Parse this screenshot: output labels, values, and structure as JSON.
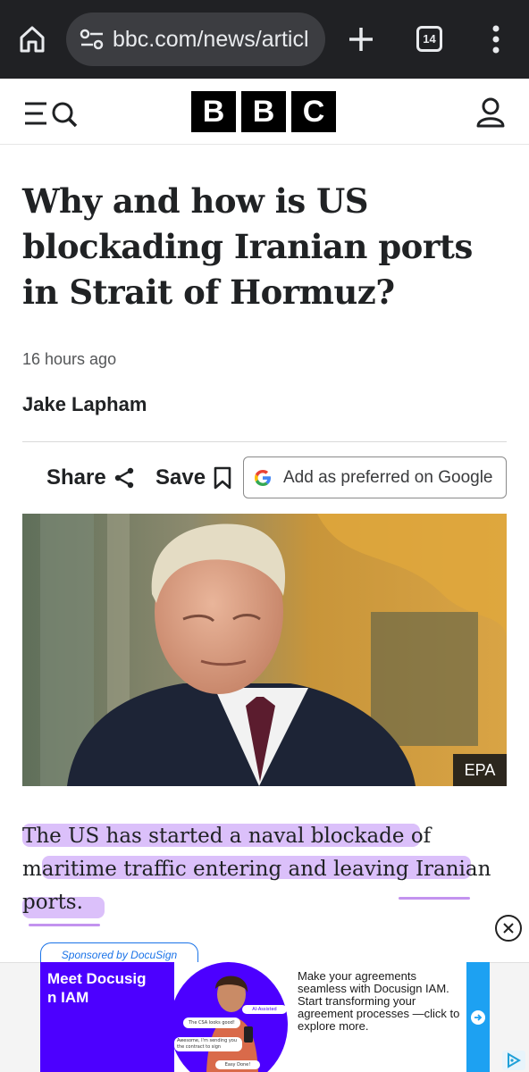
{
  "browser": {
    "url": "bbc.com/news/articl",
    "tab_count": "14",
    "icons": [
      "home-icon",
      "site-settings-icon",
      "new-tab-icon",
      "tab-switcher-icon",
      "more-menu-icon"
    ]
  },
  "site_header": {
    "logo_letters": [
      "B",
      "B",
      "C"
    ],
    "icons": [
      "menu-search-icon",
      "account-icon"
    ]
  },
  "article": {
    "headline": "Why and how is US blockading Iranian ports in Strait of Hormuz?",
    "timestamp": "16 hours ago",
    "author": "Jake Lapham",
    "actions": {
      "share_label": "Share",
      "save_label": "Save",
      "google_label": "Add as preferred on Google"
    },
    "image": {
      "credit": "EPA"
    },
    "body_first_paragraph": "The US has started a naval blockade of maritime traffic entering and leaving Iranian ports."
  },
  "ad": {
    "sponsor_label": "Sponsored by DocuSign",
    "title": "Meet Docusig n IAM",
    "copy": "Make your agreements seamless with Docusign IAM. Start transforming your agreement processes —click to explore more.",
    "mock_bubbles": [
      "AI-Assisted",
      "The CSA looks good!",
      "Awesome, I'm sending you the contract to sign",
      "Easy Done!"
    ]
  },
  "colors": {
    "chrome_bg": "#202124",
    "highlight": "#c08cf5",
    "ad_brand": "#4c00ff",
    "ad_accent": "#1da1f2"
  }
}
